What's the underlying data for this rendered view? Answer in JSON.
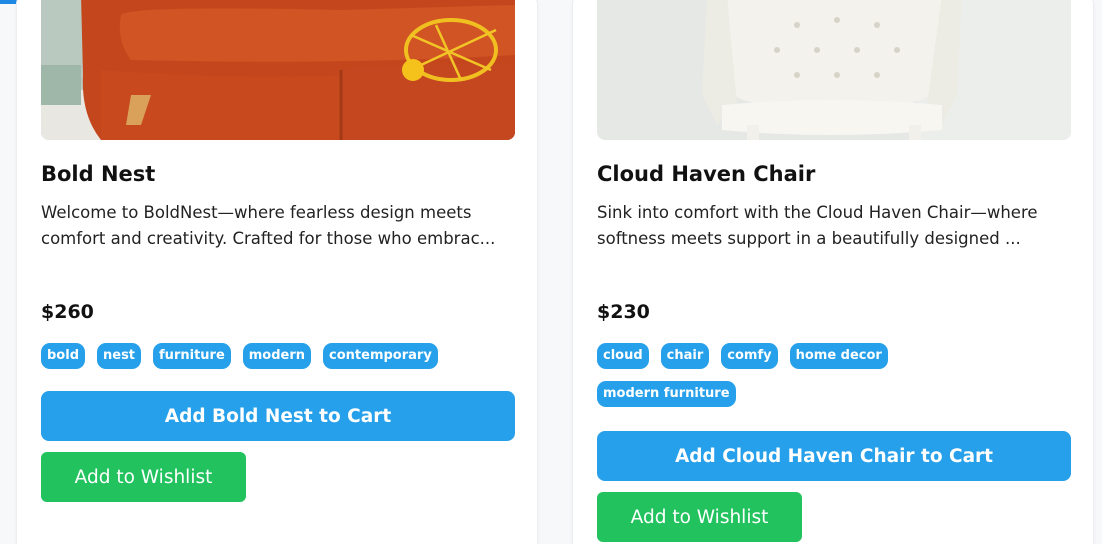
{
  "products": [
    {
      "title": "Bold Nest",
      "description": "Welcome to BoldNest—where fearless design meets comfort and creativity. Crafted for those who embrac...",
      "price": "$260",
      "tags": [
        "bold",
        "nest",
        "furniture",
        "modern",
        "contemporary"
      ],
      "cart_label": "Add Bold Nest to Cart",
      "wishlist_label": "Add to Wishlist"
    },
    {
      "title": "Cloud Haven Chair",
      "description": "Sink into comfort with the Cloud Haven Chair—where softness meets support in a beautifully designed ...",
      "price": "$230",
      "tags": [
        "cloud",
        "chair",
        "comfy",
        "home decor",
        "modern furniture"
      ],
      "cart_label": "Add Cloud Haven Chair to Cart",
      "wishlist_label": "Add to Wishlist"
    }
  ],
  "colors": {
    "primary": "#26a0ea",
    "wishlist": "#22c35e",
    "accent_tab": "#1e88e5"
  }
}
